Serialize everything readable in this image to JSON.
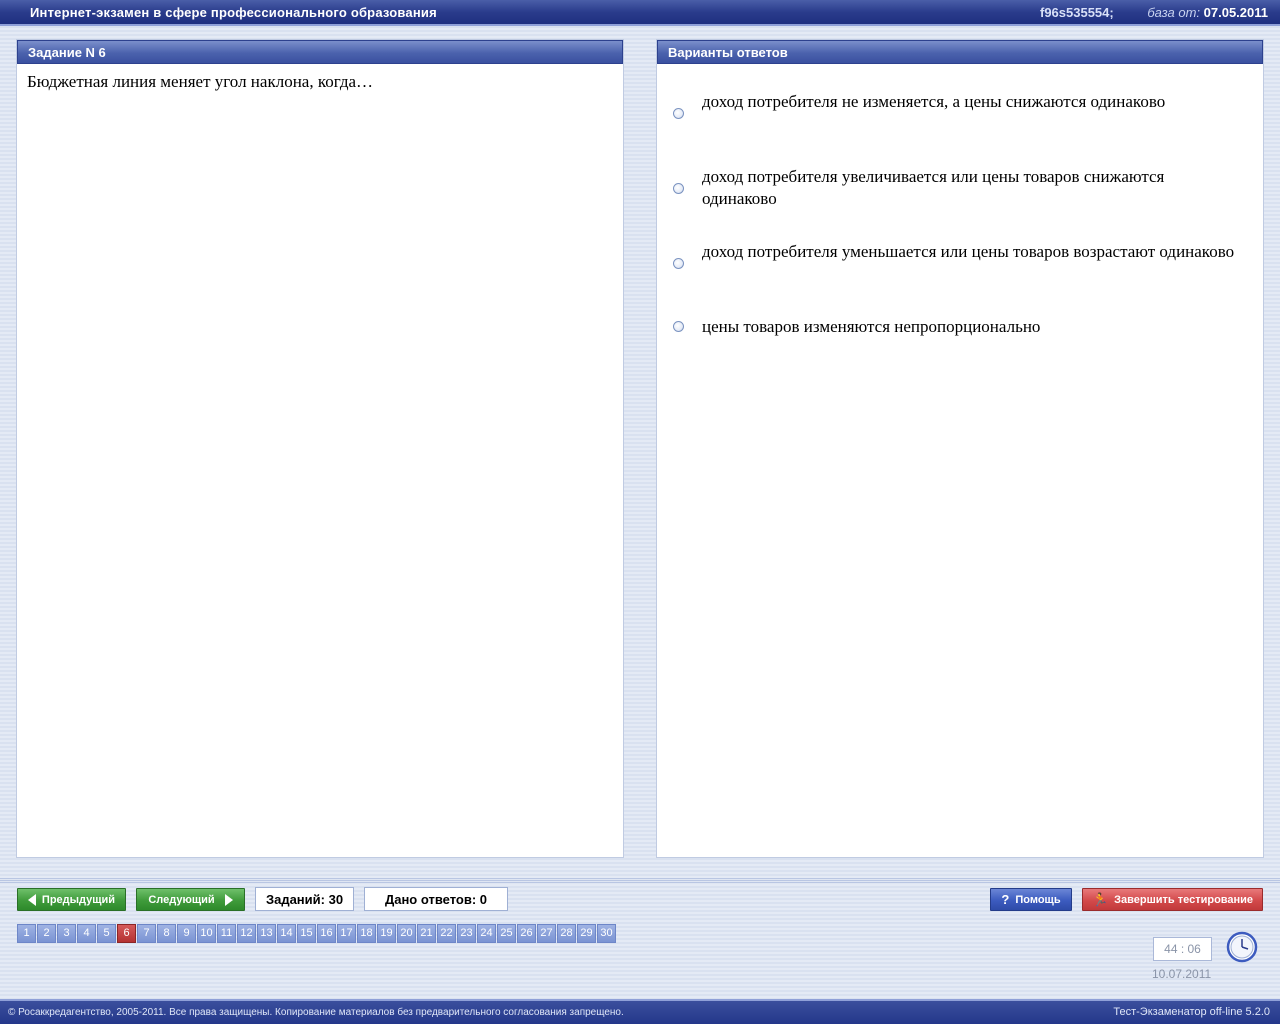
{
  "app": {
    "title": "Интернет-экзамен в сфере профессионального образования",
    "code": "f96s535554;",
    "base_label": "база от:",
    "base_date": "07.05.2011"
  },
  "question_panel": {
    "header": "Задание N 6",
    "text": "Бюджетная линия меняет угол наклона, когда…"
  },
  "answers_panel": {
    "header": "Варианты ответов",
    "options": [
      {
        "label": "доход потребителя не изменяется, а цены снижаются одинаково",
        "selected": false
      },
      {
        "label": "доход потребителя увеличивается или цены товаров снижаются одинаково",
        "selected": false
      },
      {
        "label": "доход потребителя уменьшается или цены товаров возрастают одинаково",
        "selected": false
      },
      {
        "label": "цены товаров изменяются непропорционально",
        "selected": false
      }
    ]
  },
  "controls": {
    "prev_label": "Предыдущий",
    "next_label": "Следующий",
    "tasks_count": "Заданий: 30",
    "answered_count": "Дано ответов: 0",
    "help_label": "Помощь",
    "finish_label": "Завершить тестирование"
  },
  "task_numbers": [
    "1",
    "2",
    "3",
    "4",
    "5",
    "6",
    "7",
    "8",
    "9",
    "10",
    "11",
    "12",
    "13",
    "14",
    "15",
    "16",
    "17",
    "18",
    "19",
    "20",
    "21",
    "22",
    "23",
    "24",
    "25",
    "26",
    "27",
    "28",
    "29",
    "30"
  ],
  "current_task": "6",
  "timer": "44 : 06",
  "date": "10.07.2011",
  "footer": {
    "copyright": "© Росаккредагентство, 2005-2011. Все права защищены. Копирование материалов без предварительного согласования запрещено.",
    "version": "Тест-Экзаменатор off-line 5.2.0"
  },
  "colors": {
    "title_bar": "#2a3c8c",
    "panel_header": "#4b62ad",
    "green_button": "#3f9b3b",
    "help_button": "#3c5bbf",
    "finish_button": "#d34a4b",
    "active_task": "#b43232"
  }
}
